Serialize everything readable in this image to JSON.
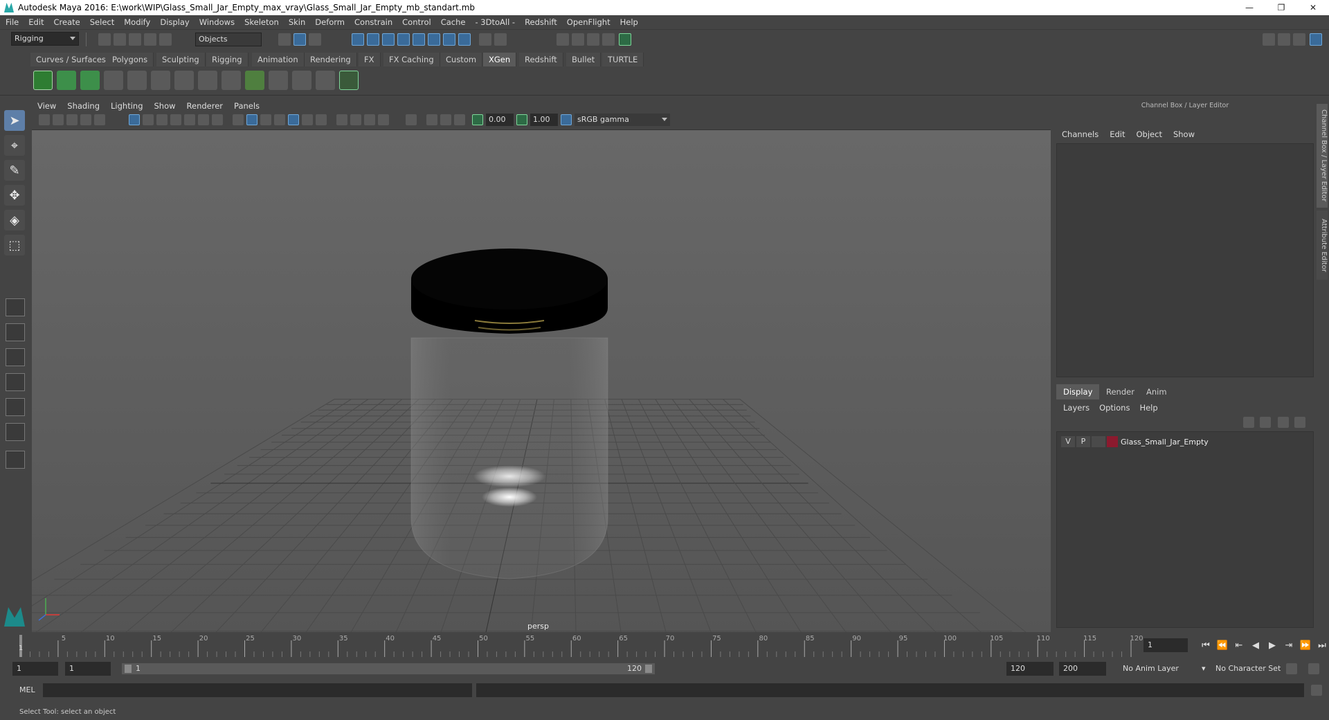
{
  "window": {
    "title": "Autodesk Maya 2016: E:\\work\\WIP\\Glass_Small_Jar_Empty_max_vray\\Glass_Small_Jar_Empty_mb_standart.mb",
    "minimize": "—",
    "restore": "❐",
    "close": "✕"
  },
  "menubar": [
    "File",
    "Edit",
    "Create",
    "Select",
    "Modify",
    "Display",
    "Windows",
    "Skeleton",
    "Skin",
    "Deform",
    "Constrain",
    "Control",
    "Cache",
    "- 3DtoAll -",
    "Redshift",
    "OpenFlight",
    "Help"
  ],
  "status": {
    "mode": "Rigging",
    "selection_mode": "Objects"
  },
  "shelf_tabs": [
    "Curves / Surfaces",
    "Polygons",
    "Sculpting",
    "Rigging",
    "Animation",
    "Rendering",
    "FX",
    "FX Caching",
    "Custom",
    "XGen",
    "Redshift",
    "Bullet",
    "TURTLE"
  ],
  "active_shelf_tab": "XGen",
  "viewport": {
    "menu": [
      "View",
      "Shading",
      "Lighting",
      "Show",
      "Renderer",
      "Panels"
    ],
    "exposure": "0.00",
    "gamma": "1.00",
    "color_space": "sRGB gamma",
    "camera_label": "persp"
  },
  "right_panel": {
    "title": "Channel Box / Layer Editor",
    "menu": [
      "Channels",
      "Edit",
      "Object",
      "Show"
    ],
    "tabs": [
      "Display",
      "Render",
      "Anim"
    ],
    "active_tab": "Display",
    "layer_menu": [
      "Layers",
      "Options",
      "Help"
    ],
    "layers": [
      {
        "v": "V",
        "p": "P",
        "color": "#8b1a2e",
        "name": "Glass_Small_Jar_Empty"
      }
    ],
    "side_tabs": [
      "Channel Box / Layer Editor",
      "Attribute Editor"
    ]
  },
  "timeline": {
    "ticks": [
      "5",
      "10",
      "15",
      "20",
      "25",
      "30",
      "35",
      "40",
      "45",
      "50",
      "55",
      "60",
      "65",
      "70",
      "75",
      "80",
      "85",
      "90",
      "95",
      "100",
      "105",
      "110",
      "115",
      "120"
    ],
    "start_label": "1",
    "current_frame": "1"
  },
  "range": {
    "start_min": "1",
    "start": "1",
    "slider_start": "1",
    "slider_end": "120",
    "end": "120",
    "end_max": "200",
    "anim_layer": "No Anim Layer",
    "character_set": "No Character Set"
  },
  "command": {
    "label": "MEL"
  },
  "help_line": "Select Tool: select an object"
}
